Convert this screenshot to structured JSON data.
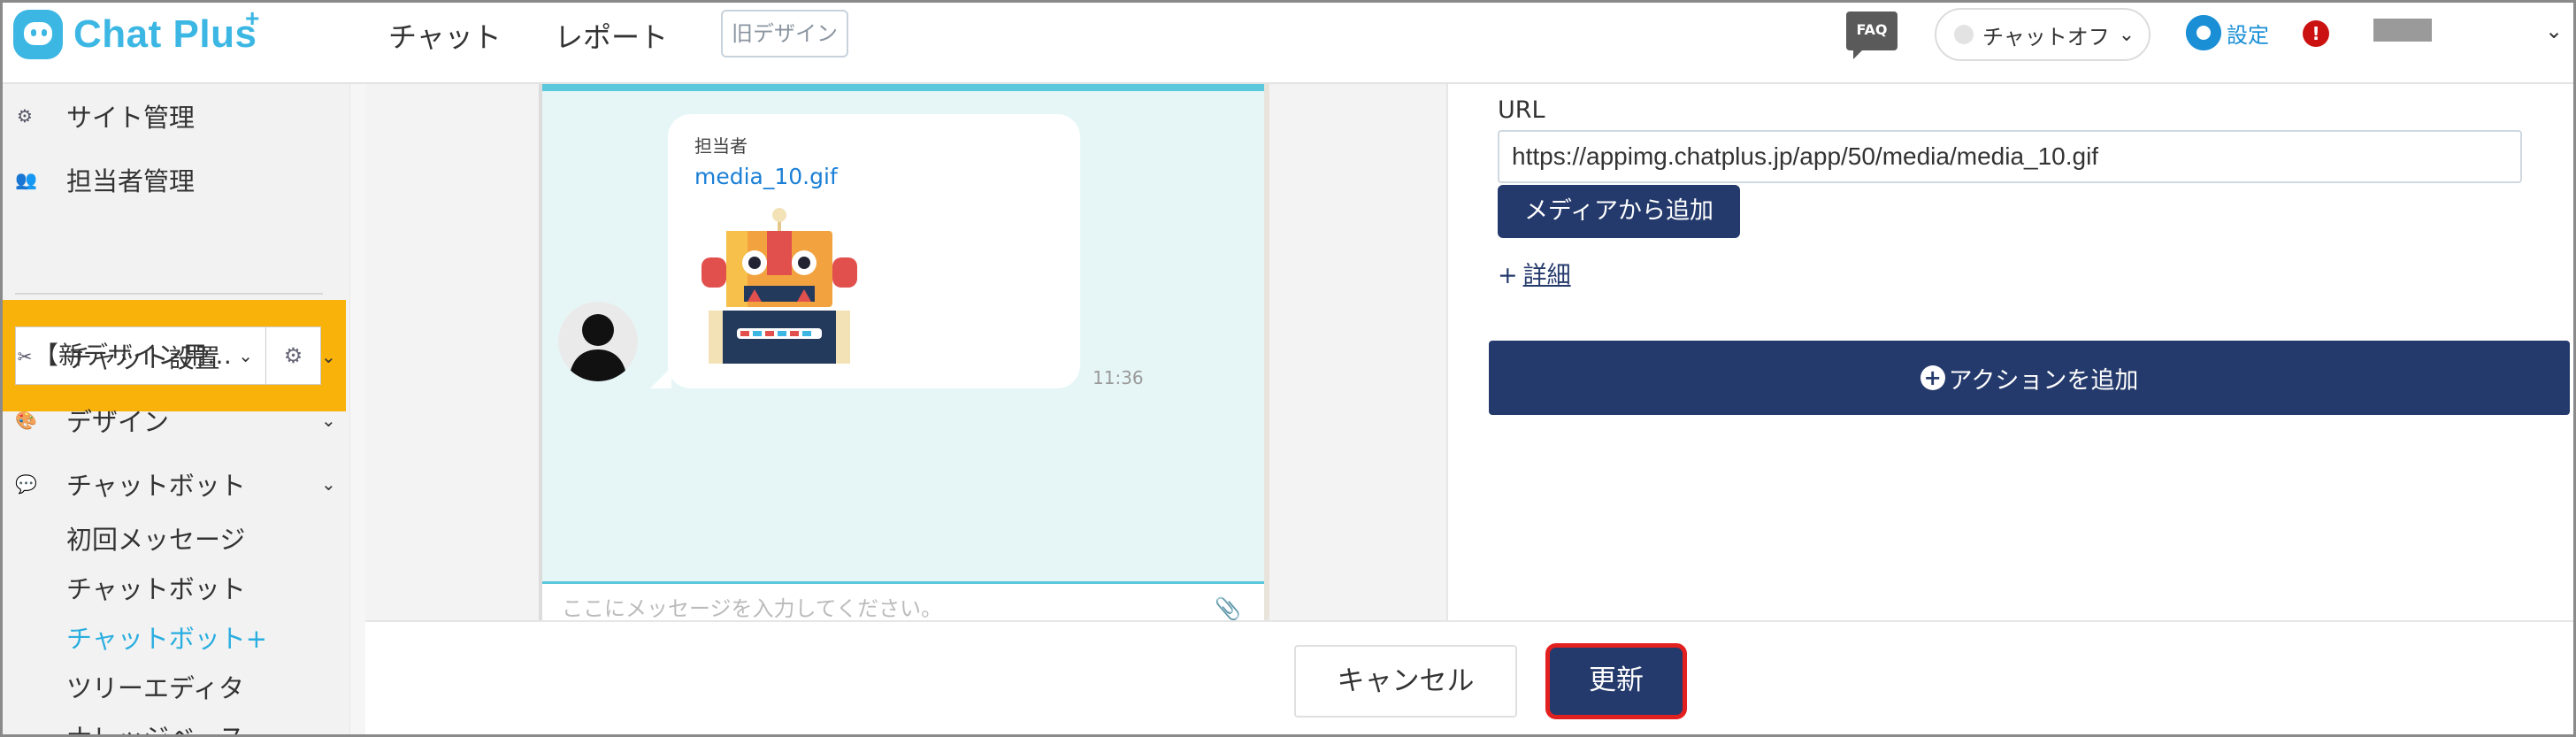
{
  "header": {
    "logo_text": "Chat Plus",
    "logo_plus": "+",
    "nav_chat": "チャット",
    "nav_report": "レポート",
    "old_design_label": "旧デザイン",
    "faq_label": "FAQ",
    "chat_status": "チャットオフ",
    "settings_label": "設定",
    "alert_label": "!"
  },
  "sidebar": {
    "site_management": "サイト管理",
    "agent_management": "担当者管理",
    "site_select_value": "【新デザイン用…",
    "chat_settings": "チャット設置",
    "design": "デザイン",
    "chatbot": "チャットボット",
    "sub_items": [
      "初回メッセージ",
      "チャットボット",
      "チャットボット+",
      "ツリーエディタ",
      "ナレッジベース"
    ],
    "active_sub_item": "チャットボット+"
  },
  "preview": {
    "agent_name": "担当者",
    "media_link": "media_10.gif",
    "message_time": "11:36",
    "input_placeholder": "ここにメッセージを入力してください。"
  },
  "right_panel": {
    "url_label": "URL",
    "url_value": "https://appimg.chatplus.jp/app/50/media/media_10.gif",
    "media_button": "メディアから追加",
    "detail_plus": "+",
    "detail_link": "詳細",
    "action_plus": "+",
    "action_button": "アクションを追加"
  },
  "footer": {
    "cancel_button": "キャンセル",
    "update_button": "更新"
  },
  "colors": {
    "brand": "#3cb7e4",
    "navy_button": "#253a6c",
    "highlight_orange": "#f9b20a",
    "highlight_red": "#e32020",
    "active_link": "#2aaee0"
  }
}
